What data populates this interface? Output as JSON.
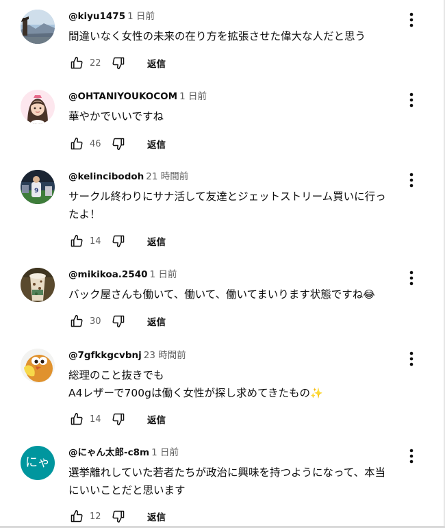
{
  "comments": [
    {
      "author": "@kiyu1475",
      "time": "1 日前",
      "text_lines": [
        "間違いなく女性の未来の在り方を拡張させた偉大な人だと思う"
      ],
      "likes": "22",
      "reply_label": "返信",
      "avatar": "landscape-photo"
    },
    {
      "author": "@OHTANIYOUKOCOM",
      "time": "1 日前",
      "text_lines": [
        "華やかでいいですね"
      ],
      "likes": "46",
      "reply_label": "返信",
      "avatar": "illustrated-woman"
    },
    {
      "author": "@kelincibodoh",
      "time": "21 時間前",
      "text_lines": [
        "サークル終わりにサナ活して友達とジェットストリーム買いに行っ",
        "たよ！"
      ],
      "likes": "14",
      "reply_label": "返信",
      "avatar": "baseball-stadium-photo"
    },
    {
      "author": "@mikikoa.2540",
      "time": "1 日前",
      "text_lines": [
        "バック屋さんも働いて、働いて、働いてまいります状態ですね"
      ],
      "emoji": "😂",
      "likes": "30",
      "reply_label": "返信",
      "avatar": "coffee-drink-photo"
    },
    {
      "author": "@7gfkkgcvbnj",
      "time": "23 時間前",
      "text_lines": [
        "総理のこと抜きでも",
        "A4レザーで700gは働く女性が探し求めてきたもの"
      ],
      "emoji": "✨",
      "likes": "14",
      "reply_label": "返信",
      "avatar": "cartoon-bird"
    },
    {
      "author": "@にゃん太郎-c8m",
      "time": "1 日前",
      "text_lines": [
        "選挙離れしていた若者たちが政治に興味を持つようになって、本当",
        "にいいことだと思います"
      ],
      "likes": "12",
      "reply_label": "返信",
      "avatar": "initial-letter",
      "avatar_text": "にゃ",
      "avatar_color": "#00969e"
    }
  ],
  "icons": {
    "like": "thumbs-up-icon",
    "dislike": "thumbs-down-icon",
    "menu": "more-vertical-icon"
  },
  "colors": {
    "text_primary": "#0f0f0f",
    "text_secondary": "#606060"
  }
}
